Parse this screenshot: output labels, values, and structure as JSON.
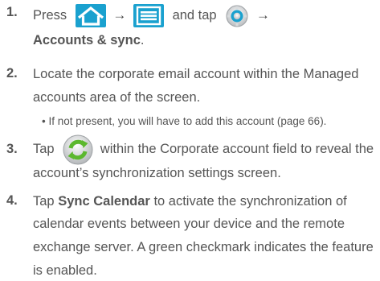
{
  "steps": [
    {
      "number": "1.",
      "press": "Press",
      "arrow1": "→",
      "and_tap": "and tap",
      "arrow2": "→",
      "target": "Accounts & sync",
      "period": "."
    },
    {
      "number": "2.",
      "line1": "Locate the corporate email account within the Managed",
      "line2": "accounts area of the screen.",
      "bullet": "• If not present, you will have to add this account (page 66)."
    },
    {
      "number": "3.",
      "tap": "Tap",
      "line1_rest": "within the Corporate account field to reveal the",
      "line2": "account’s synchronization settings screen."
    },
    {
      "number": "4.",
      "tap": "Tap",
      "bold": "Sync Calendar",
      "line1_rest": "to activate the synchronization of",
      "line2": "calendar events between your device and the remote",
      "line3": "exchange server. A green checkmark indicates the feature",
      "line4": "is enabled."
    }
  ],
  "icons": {
    "home": "home-icon",
    "menu": "menu-icon",
    "settings": "settings-icon",
    "sync": "sync-icon"
  },
  "colors": {
    "tile": "#1aa1cf",
    "sync_green": "#5cb82e",
    "text": "#555555"
  }
}
